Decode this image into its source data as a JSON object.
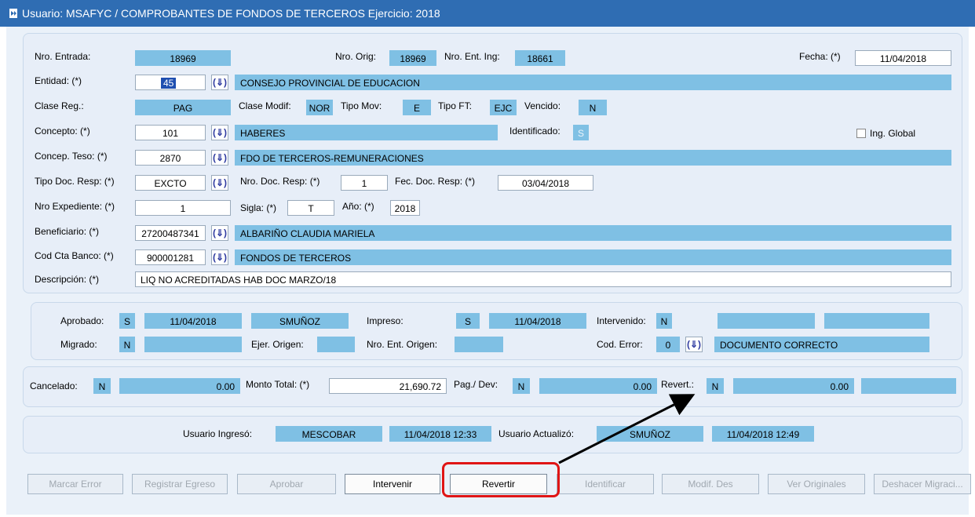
{
  "window": {
    "title": "Usuario: MSAFYC  /  COMPROBANTES DE FONDOS DE TERCEROS  Ejercicio: 2018"
  },
  "form": {
    "nro_entrada": {
      "label": "Nro. Entrada:",
      "value": "18969"
    },
    "nro_orig": {
      "label": "Nro. Orig:",
      "value": "18969"
    },
    "nro_ent_ing": {
      "label": "Nro. Ent. Ing:",
      "value": "18661"
    },
    "fecha": {
      "label": "Fecha: (*)",
      "value": "11/04/2018"
    },
    "entidad": {
      "label": "Entidad: (*)",
      "value": "45",
      "desc": "CONSEJO PROVINCIAL DE EDUCACION"
    },
    "clase_reg": {
      "label": "Clase Reg.:",
      "value": "PAG"
    },
    "clase_modif": {
      "label": "Clase Modif:",
      "value": "NOR"
    },
    "tipo_mov": {
      "label": "Tipo Mov:",
      "value": "E"
    },
    "tipo_ft": {
      "label": "Tipo FT:",
      "value": "EJC"
    },
    "vencido": {
      "label": "Vencido:",
      "value": "N"
    },
    "concepto": {
      "label": "Concepto: (*)",
      "value": "101",
      "desc": "HABERES"
    },
    "identificado": {
      "label": "Identificado:",
      "value": "S"
    },
    "ing_global": {
      "label": "Ing. Global"
    },
    "concep_teso": {
      "label": "Concep. Teso: (*)",
      "value": "2870",
      "desc": "FDO DE TERCEROS-REMUNERACIONES"
    },
    "tipo_doc_resp": {
      "label": "Tipo Doc. Resp: (*)",
      "value": "EXCTO"
    },
    "nro_doc_resp": {
      "label": "Nro. Doc. Resp: (*)",
      "value": "1"
    },
    "fec_doc_resp": {
      "label": "Fec. Doc. Resp: (*)",
      "value": "03/04/2018"
    },
    "nro_expediente": {
      "label": "Nro Expediente: (*)",
      "value": "1"
    },
    "sigla": {
      "label": "Sigla: (*)",
      "value": "T"
    },
    "anio": {
      "label": "Año: (*)",
      "value": "2018"
    },
    "beneficiario": {
      "label": "Beneficiario: (*)",
      "value": "27200487341",
      "desc": "ALBARIÑO CLAUDIA MARIELA"
    },
    "cod_cta_banco": {
      "label": "Cod Cta Banco: (*)",
      "value": "900001281",
      "desc": "FONDOS DE TERCEROS"
    },
    "descripcion": {
      "label": "Descripción: (*)",
      "value": "LIQ NO ACREDITADAS HAB DOC MARZO/18"
    },
    "lov_icon": "(⇓)"
  },
  "status": {
    "aprobado": {
      "label": "Aprobado:",
      "flag": "S",
      "date": "11/04/2018",
      "user": "SMUÑOZ"
    },
    "impreso": {
      "label": "Impreso:",
      "flag": "S",
      "date": "11/04/2018"
    },
    "intervenido": {
      "label": "Intervenido:",
      "flag": "N"
    },
    "migrado": {
      "label": "Migrado:",
      "flag": "N"
    },
    "ejer_origen": {
      "label": "Ejer. Origen:"
    },
    "nro_ent_origen": {
      "label": "Nro. Ent. Origen:"
    },
    "cod_error": {
      "label": "Cod. Error:",
      "value": "0",
      "desc": "DOCUMENTO CORRECTO"
    }
  },
  "amounts": {
    "cancelado": {
      "label": "Cancelado:",
      "flag": "N",
      "value": "0.00"
    },
    "monto_total": {
      "label": "Monto Total: (*)",
      "value": "21,690.72"
    },
    "pag_dev": {
      "label": "Pag./ Dev:",
      "flag": "N",
      "value": "0.00"
    },
    "revert": {
      "label": "Revert.:",
      "flag": "N",
      "value": "0.00"
    }
  },
  "audit": {
    "usuario_ingreso": {
      "label": "Usuario Ingresó:",
      "user": "MESCOBAR",
      "date": "11/04/2018 12:33"
    },
    "usuario_actualizo": {
      "label": "Usuario Actualizó:",
      "user": "SMUÑOZ",
      "date": "11/04/2018 12:49"
    }
  },
  "buttons": [
    "Marcar Error",
    "Registrar Egreso",
    "Aprobar",
    "Intervenir",
    "Revertir",
    "Identificar",
    "Modif. Des",
    "Ver Originales",
    "Deshacer Migraci..."
  ],
  "colors": {
    "titlebar": "#2f6db3",
    "field_blue": "#7fc0e4",
    "highlight": "#e01515"
  }
}
